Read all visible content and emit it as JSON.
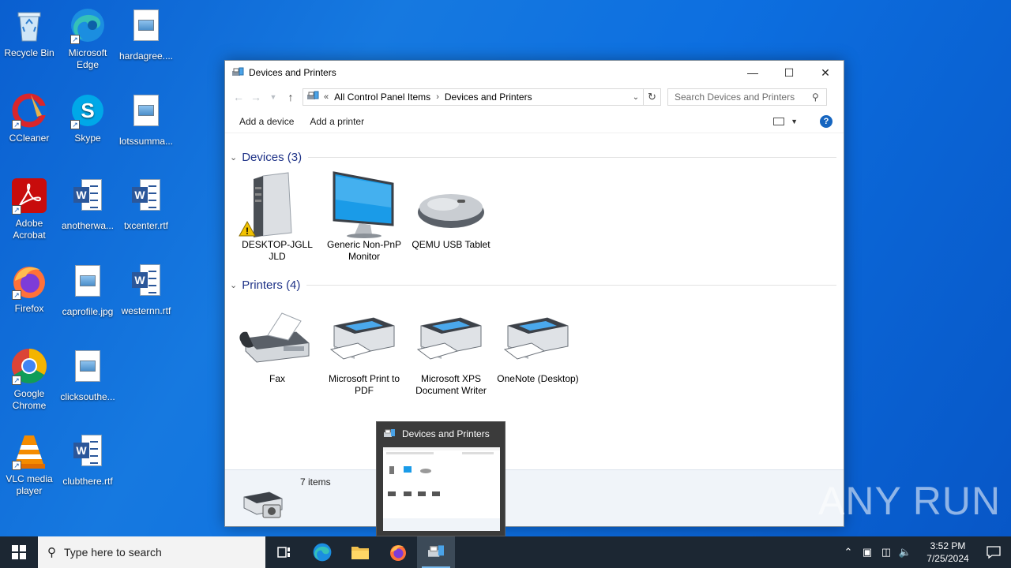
{
  "desktop": {
    "icons": [
      {
        "label": "Recycle Bin",
        "icon": "recycle-bin-icon"
      },
      {
        "label": "Microsoft Edge",
        "icon": "edge-icon"
      },
      {
        "label": "hardagree....",
        "icon": "image-file-icon"
      },
      {
        "label": "CCleaner",
        "icon": "ccleaner-icon"
      },
      {
        "label": "Skype",
        "icon": "skype-icon"
      },
      {
        "label": "lotssumma...",
        "icon": "image-file-icon"
      },
      {
        "label": "Adobe Acrobat",
        "icon": "acrobat-icon"
      },
      {
        "label": "anotherwa...",
        "icon": "word-doc-icon"
      },
      {
        "label": "txcenter.rtf",
        "icon": "word-doc-icon"
      },
      {
        "label": "Firefox",
        "icon": "firefox-icon"
      },
      {
        "label": "caprofile.jpg",
        "icon": "image-file-icon"
      },
      {
        "label": "westernn.rtf",
        "icon": "word-doc-icon"
      },
      {
        "label": "Google Chrome",
        "icon": "chrome-icon"
      },
      {
        "label": "clicksouthe...",
        "icon": "image-file-icon"
      },
      {
        "label": "VLC media player",
        "icon": "vlc-icon"
      },
      {
        "label": "clubthere.rtf",
        "icon": "word-doc-icon"
      }
    ]
  },
  "window": {
    "title": "Devices and Printers",
    "breadcrumb": {
      "overflow": "«",
      "items": [
        "All Control Panel Items",
        "Devices and Printers"
      ],
      "separator": "›"
    },
    "search_placeholder": "Search Devices and Printers",
    "commands": {
      "add_device": "Add a device",
      "add_printer": "Add a printer"
    },
    "help": "?",
    "groups": {
      "devices": {
        "header": "Devices (3)",
        "items": [
          {
            "label": "DESKTOP-JGLLJLD",
            "icon": "computer-tower-icon"
          },
          {
            "label": "Generic Non-PnP Monitor",
            "icon": "monitor-icon"
          },
          {
            "label": "QEMU USB Tablet",
            "icon": "mouse-icon"
          }
        ]
      },
      "printers": {
        "header": "Printers (4)",
        "items": [
          {
            "label": "Fax",
            "icon": "fax-icon"
          },
          {
            "label": "Microsoft Print to PDF",
            "icon": "printer-icon"
          },
          {
            "label": "Microsoft XPS Document Writer",
            "icon": "printer-icon"
          },
          {
            "label": "OneNote (Desktop)",
            "icon": "printer-icon"
          }
        ]
      }
    },
    "status": {
      "count": "7 items"
    }
  },
  "preview": {
    "title": "Devices and Printers"
  },
  "watermark": "ANY RUN",
  "taskbar": {
    "search_placeholder": "Type here to search",
    "clock_time": "3:52 PM",
    "clock_date": "7/25/2024"
  },
  "colors": {
    "accent": "#1e3287",
    "desktop": "#0a6ad8",
    "taskbar": "#1c2733"
  }
}
